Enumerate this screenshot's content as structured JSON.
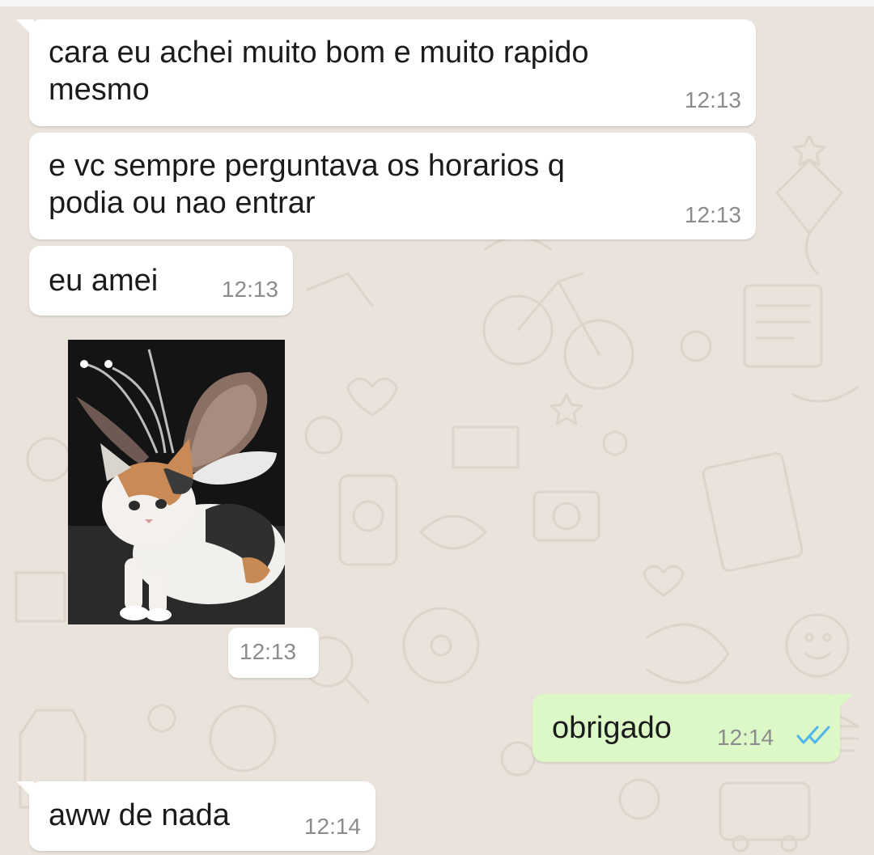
{
  "chat": {
    "messages": [
      {
        "direction": "incoming",
        "text": "cara eu achei muito bom e muito rapido\nmesmo",
        "time": "12:13"
      },
      {
        "direction": "incoming",
        "text": "e vc sempre perguntava os horarios q\npodia ou nao entrar",
        "time": "12:13"
      },
      {
        "direction": "incoming",
        "text": "eu amei",
        "time": "12:13"
      },
      {
        "direction": "incoming",
        "type": "image",
        "image_description": "calico kitten with toy antennae and butterfly wings",
        "time": "12:13"
      },
      {
        "direction": "outgoing",
        "text": "obrigado",
        "time": "12:14",
        "status": "read"
      },
      {
        "direction": "incoming",
        "text": "aww de nada",
        "time": "12:14"
      }
    ]
  },
  "colors": {
    "wallpaper": "#e9e3db",
    "incoming_bubble": "#ffffff",
    "outgoing_bubble": "#dcf8c6",
    "timestamp": "#8c8c8c",
    "read_ticks": "#4fb6ec"
  },
  "icons": {
    "read_receipt": "double-check-icon"
  }
}
